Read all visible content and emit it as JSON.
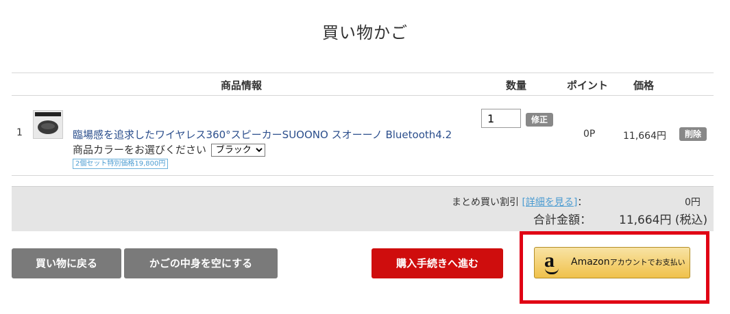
{
  "page": {
    "title": "買い物かご"
  },
  "table": {
    "headers": {
      "product": "商品情報",
      "qty": "数量",
      "points": "ポイント",
      "price": "価格"
    },
    "row": {
      "index": "1",
      "name": "臨場感を追求したワイヤレス360°スピーカーSUOONO スオーーノ Bluetooth4.2",
      "color_label": "商品カラーをお選びください",
      "color_selected": "ブラック",
      "set_badge": "2個セット特別価格19,800円",
      "qty_value": "1",
      "update_label": "修正",
      "points": "0P",
      "price": "11,664円",
      "delete_label": "削除"
    }
  },
  "summary": {
    "discount_label": "まとめ買い割引",
    "discount_link": "[詳細を見る]",
    "colon": "：",
    "discount_value": "0円",
    "total_label": "合計金額：",
    "total_value": "11,664円 (税込)"
  },
  "buttons": {
    "back": "買い物に戻る",
    "empty": "かごの中身を空にする",
    "checkout": "購入手続きへ進む",
    "amazon_logo": "a",
    "amazon_main": "Amazon",
    "amazon_small": "アカウントでお支払い"
  },
  "colors": {
    "checkout": "#cf0d0d",
    "gray_button": "#7a7a7a",
    "highlight_frame": "#e00014",
    "link": "#4a9bd1"
  }
}
